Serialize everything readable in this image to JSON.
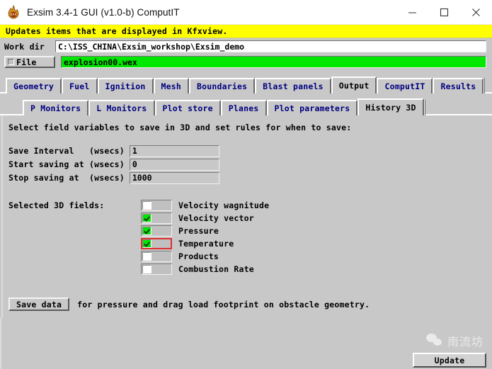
{
  "window": {
    "title": "Exsim 3.4-1 GUI (v1.0-b) ComputIT",
    "icon": "flame-kfx-icon",
    "minimize_label": "—",
    "maximize_label": "□",
    "close_label": "✕"
  },
  "message_bar": {
    "text": "Updates items that are displayed in Kfxview.",
    "background": "#ffff00"
  },
  "paths": {
    "workdir_label": "Work dir",
    "workdir_value": "C:\\ISS_CHINA\\Exsim_workshop\\Exsim_demo",
    "file_button_label": "File",
    "file_value": "explosion00.wex",
    "file_field_background": "#00e800"
  },
  "tabs_primary": [
    {
      "label": "Geometry",
      "active": false
    },
    {
      "label": "Fuel",
      "active": false
    },
    {
      "label": "Ignition",
      "active": false
    },
    {
      "label": "Mesh",
      "active": false
    },
    {
      "label": "Boundaries",
      "active": false
    },
    {
      "label": "Blast panels",
      "active": false
    },
    {
      "label": "Output",
      "active": true
    },
    {
      "label": "ComputIT",
      "active": false
    },
    {
      "label": "Results",
      "active": false
    }
  ],
  "tabs_secondary": [
    {
      "label": "P Monitors",
      "active": false
    },
    {
      "label": "L Monitors",
      "active": false
    },
    {
      "label": "Plot store",
      "active": false
    },
    {
      "label": "Planes",
      "active": false
    },
    {
      "label": "Plot parameters",
      "active": false
    },
    {
      "label": "History 3D",
      "active": true
    }
  ],
  "panel": {
    "instruction": "Select field variables to save in 3D and set rules for when to save:",
    "form_rows": [
      {
        "label": "Save Interval   (wsecs)",
        "value": "1"
      },
      {
        "label": "Start saving at (wsecs)",
        "value": "0"
      },
      {
        "label": "Stop saving at  (wsecs)",
        "value": "1000"
      }
    ],
    "fields_caption": "Selected 3D fields:",
    "fields": [
      {
        "label": "Velocity wagnitude",
        "checked": false,
        "highlighted": false
      },
      {
        "label": "Velocity vector",
        "checked": true,
        "highlighted": false
      },
      {
        "label": "Pressure",
        "checked": true,
        "highlighted": false
      },
      {
        "label": "Temperature",
        "checked": true,
        "highlighted": true
      },
      {
        "label": "Products",
        "checked": false,
        "highlighted": false
      },
      {
        "label": "Combustion Rate",
        "checked": false,
        "highlighted": false
      }
    ],
    "save_button_label": "Save data",
    "save_note": "for pressure and drag load footprint on obstacle geometry."
  },
  "footer": {
    "watermark_text": "南流坊",
    "watermark_logo": "wechat-icon",
    "update_button_label": "Update"
  },
  "colors": {
    "panel_bg": "#c8c8c8",
    "tab_inactive_text": "#000080",
    "tab_active_text": "#000000",
    "check_green": "#00e800",
    "highlight_red": "#e03030"
  }
}
